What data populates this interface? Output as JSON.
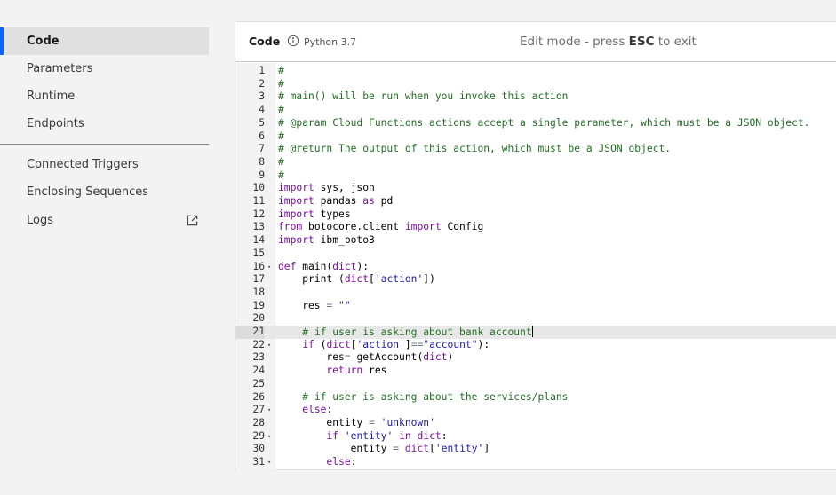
{
  "sidebar": {
    "items": [
      {
        "label": "Code",
        "active": true
      },
      {
        "label": "Parameters"
      },
      {
        "label": "Runtime"
      },
      {
        "label": "Endpoints"
      }
    ],
    "secondary_items": [
      {
        "label": "Connected Triggers"
      },
      {
        "label": "Enclosing Sequences"
      },
      {
        "label": "Logs",
        "icon": "launch-icon"
      }
    ]
  },
  "editor": {
    "title": "Code",
    "runtime": "Python 3.7",
    "mode_prefix": "Edit mode - press ",
    "mode_key": "ESC",
    "mode_suffix": " to exit",
    "current_line": 21,
    "lines": [
      {
        "n": "1",
        "fold": "",
        "t": [
          [
            "c",
            "#"
          ]
        ]
      },
      {
        "n": "2",
        "fold": "",
        "t": [
          [
            "c",
            "#"
          ]
        ]
      },
      {
        "n": "3",
        "fold": "",
        "t": [
          [
            "c",
            "# main() will be run when you invoke this action"
          ]
        ]
      },
      {
        "n": "4",
        "fold": "",
        "t": [
          [
            "c",
            "#"
          ]
        ]
      },
      {
        "n": "5",
        "fold": "",
        "t": [
          [
            "c",
            "# @param Cloud Functions actions accept a single parameter, which must be a JSON object."
          ]
        ]
      },
      {
        "n": "6",
        "fold": "",
        "t": [
          [
            "c",
            "#"
          ]
        ]
      },
      {
        "n": "7",
        "fold": "",
        "t": [
          [
            "c",
            "# @return The output of this action, which must be a JSON object."
          ]
        ]
      },
      {
        "n": "8",
        "fold": "",
        "t": [
          [
            "c",
            "#"
          ]
        ]
      },
      {
        "n": "9",
        "fold": "",
        "t": [
          [
            "c",
            "#"
          ]
        ]
      },
      {
        "n": "10",
        "fold": "",
        "t": [
          [
            "k",
            "import"
          ],
          [
            "",
            " sys, json"
          ]
        ]
      },
      {
        "n": "11",
        "fold": "",
        "t": [
          [
            "k",
            "import"
          ],
          [
            "",
            " pandas "
          ],
          [
            "k",
            "as"
          ],
          [
            "",
            " pd"
          ]
        ]
      },
      {
        "n": "12",
        "fold": "",
        "t": [
          [
            "k",
            "import"
          ],
          [
            "",
            " types"
          ]
        ]
      },
      {
        "n": "13",
        "fold": "",
        "t": [
          [
            "k",
            "from"
          ],
          [
            "",
            " botocore.client "
          ],
          [
            "k",
            "import"
          ],
          [
            "",
            " Config"
          ]
        ]
      },
      {
        "n": "14",
        "fold": "",
        "t": [
          [
            "k",
            "import"
          ],
          [
            "",
            " ibm_boto3"
          ]
        ]
      },
      {
        "n": "15",
        "fold": "",
        "t": []
      },
      {
        "n": "16",
        "fold": "▾",
        "t": [
          [
            "k",
            "def"
          ],
          [
            "",
            " main("
          ],
          [
            "k",
            "dict"
          ],
          [
            "",
            "):"
          ]
        ]
      },
      {
        "n": "17",
        "fold": "",
        "t": [
          [
            "",
            "    print ("
          ],
          [
            "k",
            "dict"
          ],
          [
            "",
            "["
          ],
          [
            "s",
            "'action'"
          ],
          [
            "",
            "])"
          ]
        ]
      },
      {
        "n": "18",
        "fold": "",
        "t": []
      },
      {
        "n": "19",
        "fold": "",
        "t": [
          [
            "",
            "    res "
          ],
          [
            "o",
            "="
          ],
          [
            "",
            " "
          ],
          [
            "s",
            "\"\""
          ]
        ]
      },
      {
        "n": "20",
        "fold": "",
        "t": []
      },
      {
        "n": "21",
        "fold": "",
        "t": [
          [
            "",
            "    "
          ],
          [
            "c",
            "# if user is asking about bank account"
          ]
        ]
      },
      {
        "n": "22",
        "fold": "▾",
        "t": [
          [
            "",
            "    "
          ],
          [
            "k",
            "if"
          ],
          [
            "",
            " ("
          ],
          [
            "k",
            "dict"
          ],
          [
            "",
            "["
          ],
          [
            "s",
            "'action'"
          ],
          [
            "",
            "]"
          ],
          [
            "o",
            "=="
          ],
          [
            "s",
            "\"account\""
          ],
          [
            "",
            "):"
          ]
        ]
      },
      {
        "n": "23",
        "fold": "",
        "t": [
          [
            "",
            "        res"
          ],
          [
            "o",
            "="
          ],
          [
            "",
            " getAccount("
          ],
          [
            "k",
            "dict"
          ],
          [
            "",
            ")"
          ]
        ]
      },
      {
        "n": "24",
        "fold": "",
        "t": [
          [
            "",
            "        "
          ],
          [
            "k",
            "return"
          ],
          [
            "",
            " res"
          ]
        ]
      },
      {
        "n": "25",
        "fold": "",
        "t": []
      },
      {
        "n": "26",
        "fold": "",
        "t": [
          [
            "",
            "    "
          ],
          [
            "c",
            "# if user is asking about the services/plans"
          ]
        ]
      },
      {
        "n": "27",
        "fold": "▾",
        "t": [
          [
            "",
            "    "
          ],
          [
            "k",
            "else"
          ],
          [
            "",
            ":"
          ]
        ]
      },
      {
        "n": "28",
        "fold": "",
        "t": [
          [
            "",
            "        entity "
          ],
          [
            "o",
            "="
          ],
          [
            "",
            " "
          ],
          [
            "s",
            "'unknown'"
          ]
        ]
      },
      {
        "n": "29",
        "fold": "▾",
        "t": [
          [
            "",
            "        "
          ],
          [
            "k",
            "if"
          ],
          [
            "",
            " "
          ],
          [
            "s",
            "'entity'"
          ],
          [
            "",
            " "
          ],
          [
            "k",
            "in"
          ],
          [
            "",
            " "
          ],
          [
            "k",
            "dict"
          ],
          [
            "",
            ":"
          ]
        ]
      },
      {
        "n": "30",
        "fold": "",
        "t": [
          [
            "",
            "            entity "
          ],
          [
            "o",
            "="
          ],
          [
            "",
            " "
          ],
          [
            "k",
            "dict"
          ],
          [
            "",
            "["
          ],
          [
            "s",
            "'entity'"
          ],
          [
            "",
            "]"
          ]
        ]
      },
      {
        "n": "31",
        "fold": "▾",
        "t": [
          [
            "",
            "        "
          ],
          [
            "k",
            "else"
          ],
          [
            "",
            ":"
          ]
        ]
      }
    ]
  }
}
